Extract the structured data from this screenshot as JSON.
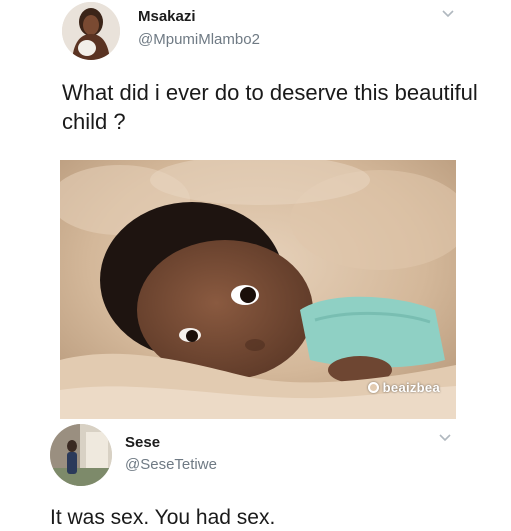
{
  "tweet1": {
    "author_name": "Msakazi",
    "author_handle": "@MpumiMlambo2",
    "text": "What did i ever do to deserve this beautiful child ?",
    "menu_icon": "chevron-down-icon",
    "avatar": "profile-photo",
    "photo": {
      "watermark": "beaizbea",
      "watermark_icon": "instagram-icon"
    }
  },
  "tweet2": {
    "author_name": "Sese",
    "author_handle": "@SeseTetiwe",
    "text": "It was sex. You had sex.",
    "menu_icon": "chevron-down-icon",
    "avatar": "profile-photo"
  },
  "colors": {
    "text": "#1a1a1a",
    "handle": "#6f7a84",
    "chevron": "#b0b8bf",
    "blanket": "#d9c0a4",
    "onesie": "#8fd0c4"
  }
}
